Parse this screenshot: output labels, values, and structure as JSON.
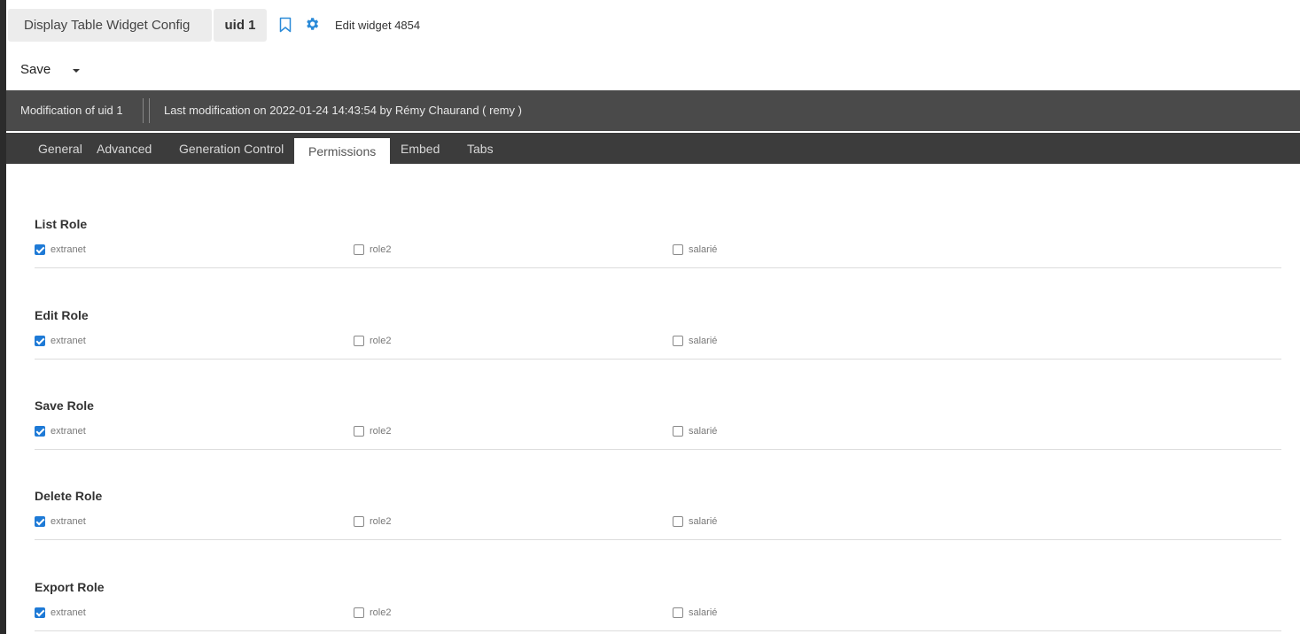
{
  "header": {
    "title": "Display Table Widget Config",
    "uid": "uid 1",
    "edit_label": "Edit widget 4854",
    "bookmark_icon": "bookmark-icon",
    "gear_icon": "gear-icon",
    "accent_color": "#1e7ad6"
  },
  "toolbar": {
    "save_label": "Save",
    "save_caret_icon": "caret-down-icon"
  },
  "infobar": {
    "modification": "Modification of uid 1",
    "last_modification": "Last modification on 2022-01-24 14:43:54 by Rémy Chaurand ( remy )"
  },
  "tabs": [
    {
      "label": "General",
      "active": false
    },
    {
      "label": "Advanced",
      "active": false
    },
    {
      "label": "Generation Control",
      "active": false
    },
    {
      "label": "Permissions",
      "active": true
    },
    {
      "label": "Embed",
      "active": false
    },
    {
      "label": "Tabs",
      "active": false
    }
  ],
  "sections": [
    {
      "title": "List Role",
      "options": [
        {
          "label": "extranet",
          "checked": true
        },
        {
          "label": "role2",
          "checked": false
        },
        {
          "label": "salarié",
          "checked": false
        }
      ]
    },
    {
      "title": "Edit Role",
      "options": [
        {
          "label": "extranet",
          "checked": true
        },
        {
          "label": "role2",
          "checked": false
        },
        {
          "label": "salarié",
          "checked": false
        }
      ]
    },
    {
      "title": "Save Role",
      "options": [
        {
          "label": "extranet",
          "checked": true
        },
        {
          "label": "role2",
          "checked": false
        },
        {
          "label": "salarié",
          "checked": false
        }
      ]
    },
    {
      "title": "Delete Role",
      "options": [
        {
          "label": "extranet",
          "checked": true
        },
        {
          "label": "role2",
          "checked": false
        },
        {
          "label": "salarié",
          "checked": false
        }
      ]
    },
    {
      "title": "Export Role",
      "options": [
        {
          "label": "extranet",
          "checked": true
        },
        {
          "label": "role2",
          "checked": false
        },
        {
          "label": "salarié",
          "checked": false
        }
      ]
    }
  ]
}
